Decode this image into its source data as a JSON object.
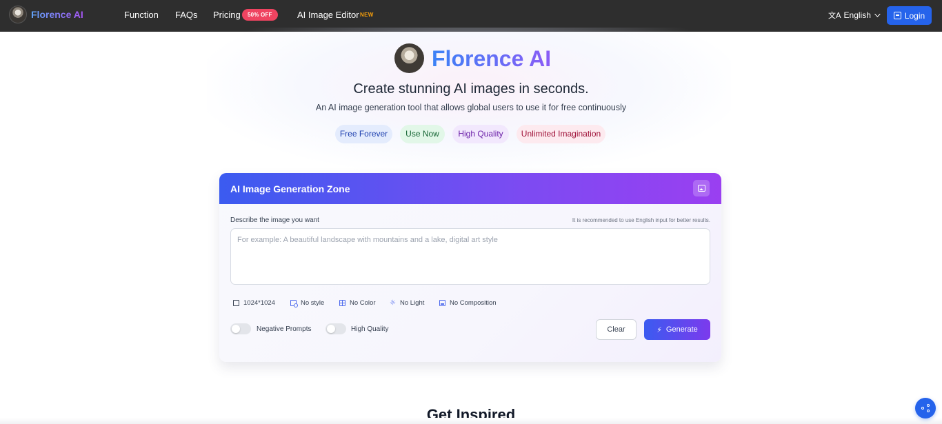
{
  "nav": {
    "brand": "Florence AI",
    "links": [
      "Function",
      "FAQs",
      "Pricing",
      "AI Image Editor"
    ],
    "pricing_badge": "50% OFF",
    "editor_badge": "NEW",
    "language": "English",
    "login": "Login",
    "icons": [
      "avatar",
      "translate-icon",
      "chevron-down-icon",
      "login-icon"
    ]
  },
  "hero": {
    "title": "Florence AI",
    "subtitle": "Create stunning AI images in seconds.",
    "description": "An AI image generation tool that allows global users to use it for free continuously",
    "chips": [
      "Free Forever",
      "Use Now",
      "High Quality",
      "Unlimited Imagination"
    ]
  },
  "generator": {
    "title": "AI Image Generation Zone",
    "prompt_label": "Describe the image you want",
    "prompt_hint": "It is recommended to use English input for better results.",
    "prompt_value": "",
    "prompt_placeholder": "For example: A beautiful landscape with mountains and a lake, digital art style",
    "options": [
      "1024*1024",
      "No style",
      "No Color",
      "No Light",
      "No Composition"
    ],
    "toggles": [
      {
        "label": "Negative Prompts",
        "on": false
      },
      {
        "label": "High Quality",
        "on": false
      }
    ],
    "clear_label": "Clear",
    "generate_label": "Generate",
    "accent": "#3b5bf0"
  },
  "section": {
    "inspired_title": "Get Inspired"
  }
}
